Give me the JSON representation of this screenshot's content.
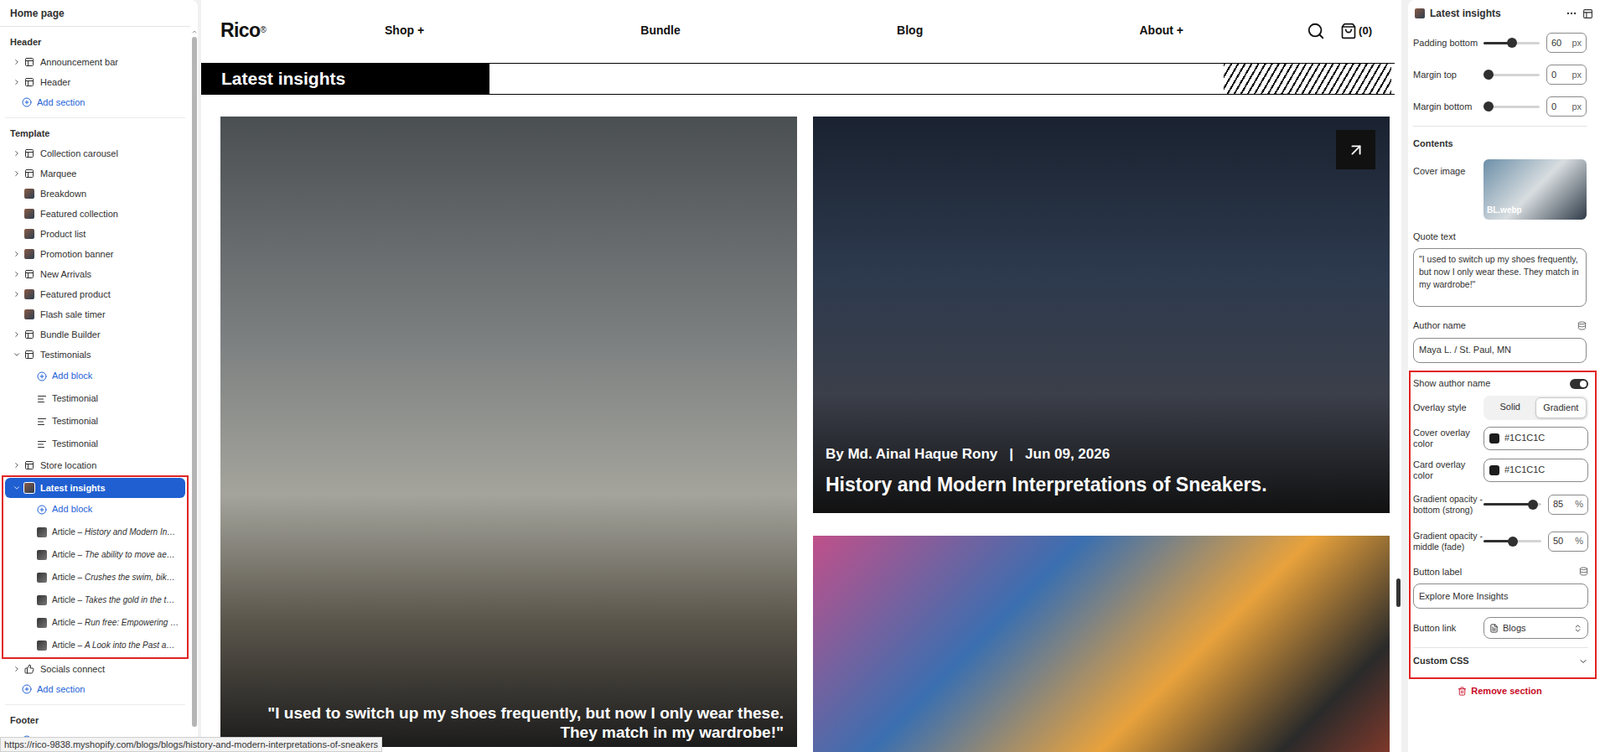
{
  "sidebar": {
    "title": "Home page",
    "groups": [
      {
        "label": "Header",
        "items": [
          {
            "label": "Announcement bar",
            "kind": "section",
            "expandable": true,
            "expanded": false,
            "selected": false,
            "children": []
          },
          {
            "label": "Header",
            "kind": "section",
            "expandable": true,
            "expanded": false,
            "selected": false,
            "children": []
          }
        ],
        "add_label": "Add section"
      },
      {
        "label": "Template",
        "items": [
          {
            "label": "Collection carousel",
            "kind": "section",
            "expandable": true,
            "expanded": false,
            "selected": false,
            "children": []
          },
          {
            "label": "Marquee",
            "kind": "section",
            "expandable": true,
            "expanded": false,
            "selected": false,
            "children": []
          },
          {
            "label": "Breakdown",
            "kind": "thumbnail",
            "expandable": false,
            "expanded": false,
            "selected": false,
            "children": []
          },
          {
            "label": "Featured collection",
            "kind": "thumbnail",
            "expandable": false,
            "expanded": false,
            "selected": false,
            "children": []
          },
          {
            "label": "Product list",
            "kind": "thumbnail",
            "expandable": false,
            "expanded": false,
            "selected": false,
            "children": []
          },
          {
            "label": "Promotion banner",
            "kind": "thumbnail",
            "expandable": true,
            "expanded": false,
            "selected": false,
            "children": []
          },
          {
            "label": "New Arrivals",
            "kind": "section",
            "expandable": true,
            "expanded": false,
            "selected": false,
            "children": []
          },
          {
            "label": "Featured product",
            "kind": "thumbnail",
            "expandable": true,
            "expanded": false,
            "selected": false,
            "children": []
          },
          {
            "label": "Flash sale timer",
            "kind": "thumbnail",
            "expandable": false,
            "expanded": false,
            "selected": false,
            "children": []
          },
          {
            "label": "Bundle Builder",
            "kind": "section",
            "expandable": true,
            "expanded": false,
            "selected": false,
            "children": []
          },
          {
            "label": "Testimonials",
            "kind": "section",
            "expandable": true,
            "expanded": true,
            "selected": false,
            "children": [
              {
                "kind": "add",
                "prefix": "",
                "title": "Add block"
              },
              {
                "kind": "block",
                "prefix": "",
                "title": "Testimonial"
              },
              {
                "kind": "block",
                "prefix": "",
                "title": "Testimonial"
              },
              {
                "kind": "block",
                "prefix": "",
                "title": "Testimonial"
              }
            ]
          },
          {
            "label": "Store location",
            "kind": "section",
            "expandable": true,
            "expanded": false,
            "selected": false,
            "children": []
          },
          {
            "label": "Latest insights",
            "kind": "thumbnail",
            "expandable": true,
            "expanded": true,
            "selected": true,
            "children": [
              {
                "kind": "add",
                "prefix": "",
                "title": "Add block"
              },
              {
                "kind": "article",
                "prefix": "Article –",
                "title": "History and Modern In…"
              },
              {
                "kind": "article",
                "prefix": "Article –",
                "title": "The ability to move ae…"
              },
              {
                "kind": "article",
                "prefix": "Article –",
                "title": "Crushes the swim, bik…"
              },
              {
                "kind": "article",
                "prefix": "Article –",
                "title": "Takes the gold in the t…"
              },
              {
                "kind": "article",
                "prefix": "Article –",
                "title": "Run free: Empowering …"
              },
              {
                "kind": "article",
                "prefix": "Article –",
                "title": "A Look into the Past a…"
              }
            ]
          },
          {
            "label": "Socials connect",
            "kind": "social",
            "expandable": true,
            "expanded": false,
            "selected": false,
            "children": []
          }
        ],
        "add_label": "Add section"
      },
      {
        "label": "Footer",
        "items": [],
        "add_label": "Add section"
      }
    ]
  },
  "store_nav": {
    "logo": "Rico",
    "logo_mark": "®",
    "links": [
      "Shop +",
      "Bundle",
      "Blog",
      "About +"
    ],
    "cart_count": "(0)"
  },
  "section_title": "Latest insights",
  "feature_card": {
    "quote": "\"I used to switch up my shoes frequently, but now I only wear these. They match in my wardrobe!\""
  },
  "article_card": {
    "author": "By Md. Ainal Haque Rony",
    "separator": "|",
    "date": "Jun 09, 2026",
    "title": "History and Modern Interpretations of Sneakers."
  },
  "status_url": "https://rico-9838.myshopify.com/blogs/blogs/history-and-modern-interpretations-of-sneakers",
  "settings": {
    "title": "Latest insights",
    "spacing": [
      {
        "label": "Padding bottom",
        "level": 0.5,
        "value": "60",
        "unit": "px"
      },
      {
        "label": "Margin top",
        "level": 0,
        "value": "0",
        "unit": "px"
      },
      {
        "label": "Margin bottom",
        "level": 0,
        "value": "0",
        "unit": "px"
      }
    ],
    "contents_heading": "Contents",
    "cover_image": {
      "label": "Cover image",
      "file": "BL.webp"
    },
    "quote": {
      "label": "Quote text",
      "value": "\"I used to switch up my shoes frequently, but now I only wear these. They match in my wardrobe!\""
    },
    "author": {
      "label": "Author name",
      "value": "Maya L. / St. Paul, MN"
    },
    "show_author": {
      "label": "Show author name",
      "on": true
    },
    "overlay_style": {
      "label": "Overlay style",
      "options": [
        {
          "label": "Solid",
          "selected": false
        },
        {
          "label": "Gradient",
          "selected": true
        }
      ]
    },
    "colors": [
      {
        "label": "Cover overlay color",
        "value": "#1C1C1C"
      },
      {
        "label": "Card overlay color",
        "value": "#1C1C1C"
      }
    ],
    "opacity": [
      {
        "label": "Gradient opacity - bottom (strong)",
        "level": 0.85,
        "value": "85",
        "unit": "%"
      },
      {
        "label": "Gradient opacity - middle (fade)",
        "level": 0.5,
        "value": "50",
        "unit": "%"
      }
    ],
    "button_label": {
      "label": "Button label",
      "value": "Explore More Insights"
    },
    "button_link": {
      "label": "Button link",
      "value": "Blogs"
    },
    "custom_css": {
      "label": "Custom CSS",
      "expanded": false
    },
    "remove": "Remove section"
  }
}
